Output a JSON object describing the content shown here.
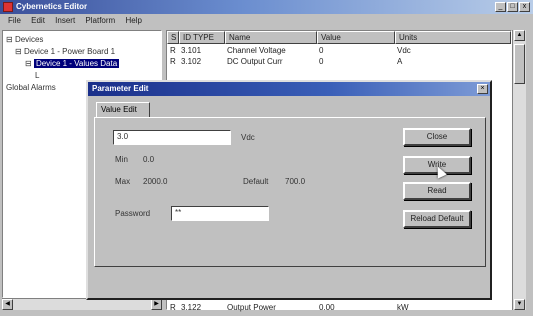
{
  "window": {
    "title": "Cybernetics Editor",
    "controls": [
      "_",
      "□",
      "x"
    ]
  },
  "menu": [
    "File",
    "Edit",
    "Insert",
    "Platform",
    "Help"
  ],
  "tree": {
    "items": [
      {
        "label": "Devices",
        "expander": "⊟"
      },
      {
        "label": "Device 1 - Power Board 1",
        "expander": "⊟"
      },
      {
        "label": "Device 1 - Values Data",
        "expander": "⊟",
        "selected": true
      },
      {
        "label": "L",
        "expander": ""
      },
      {
        "label": "Global Alarms",
        "expander": ""
      }
    ]
  },
  "list": {
    "columns": [
      "S",
      "ID TYPE",
      "Name",
      "Value",
      "Units"
    ],
    "rows": [
      {
        "flag": "R",
        "id": "3.101",
        "name": "Channel Voltage",
        "value": "0",
        "units": "Vdc"
      },
      {
        "flag": "R",
        "id": "3.102",
        "name": "DC Output Curr",
        "value": "0",
        "units": "A"
      },
      {
        "flag": "R",
        "id": "3.122",
        "name": "Output Power",
        "value": "0.00",
        "units": "kW"
      }
    ]
  },
  "dialog": {
    "title": "Parameter Edit",
    "tab": "Value Edit",
    "value_field": "3.0",
    "value_unit": "Vdc",
    "min_label": "Min",
    "min_value": "0.0",
    "max_label": "Max",
    "max_value": "2000.0",
    "default_label": "Default",
    "default_value": "700.0",
    "password_label": "Password",
    "password_value": "**",
    "buttons": {
      "close": "Close",
      "write": "Write",
      "read": "Read",
      "reload": "Reload Default"
    }
  }
}
